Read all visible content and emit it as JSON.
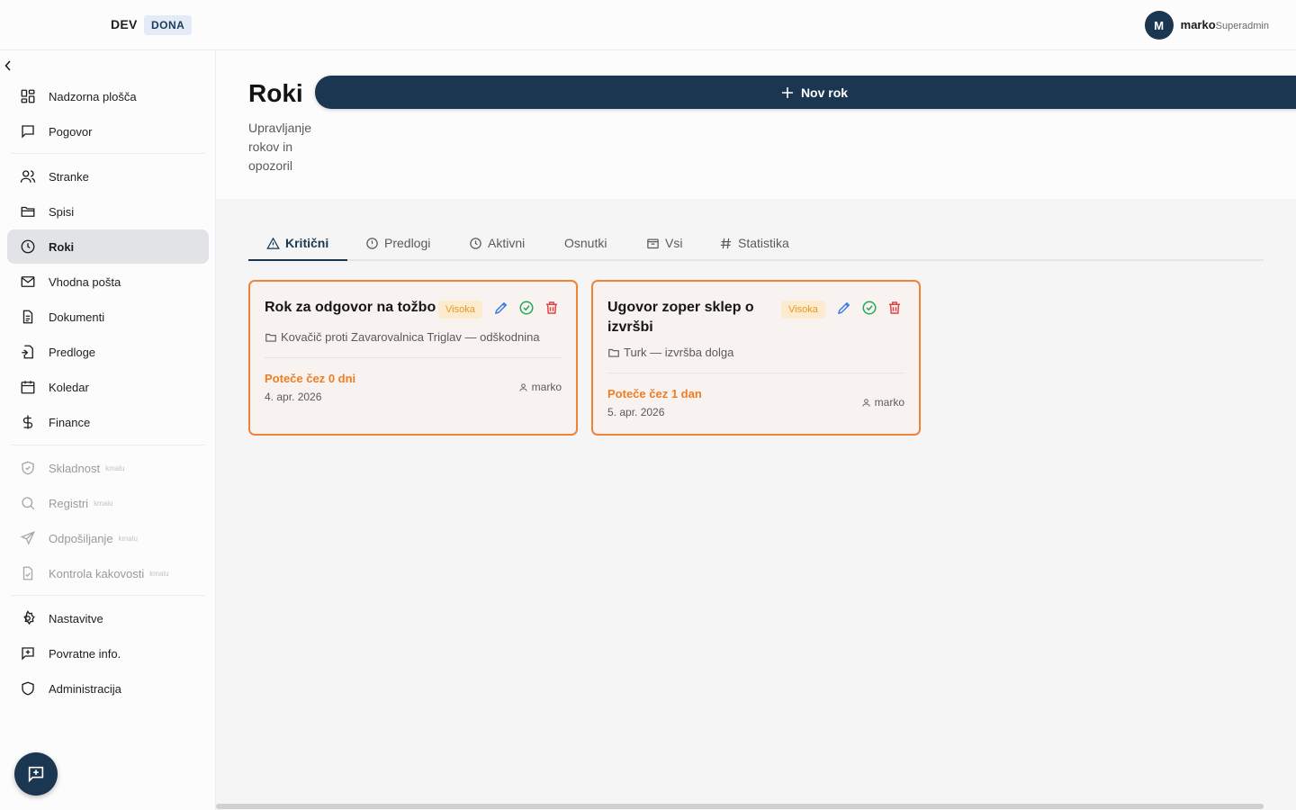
{
  "header": {
    "env": "DEV",
    "tenant": "DONA",
    "user": {
      "initial": "M",
      "name": "marko",
      "role": "Superadmin"
    }
  },
  "sidebar": {
    "items": [
      {
        "label": "Nadzorna plošča",
        "icon": "dashboard-icon"
      },
      {
        "label": "Pogovor",
        "icon": "chat-icon"
      },
      {
        "label": "Stranke",
        "icon": "users-icon"
      },
      {
        "label": "Spisi",
        "icon": "folder-icon"
      },
      {
        "label": "Roki",
        "icon": "clock-icon",
        "active": true
      },
      {
        "label": "Vhodna pošta",
        "icon": "mail-icon"
      },
      {
        "label": "Dokumenti",
        "icon": "document-icon"
      },
      {
        "label": "Predloge",
        "icon": "template-icon"
      },
      {
        "label": "Koledar",
        "icon": "calendar-icon"
      },
      {
        "label": "Finance",
        "icon": "dollar-icon"
      },
      {
        "label": "Skladnost",
        "icon": "shield-check-icon",
        "soon": "kmalu"
      },
      {
        "label": "Registri",
        "icon": "search-icon",
        "soon": "kmalu"
      },
      {
        "label": "Odpošiljanje",
        "icon": "send-icon",
        "soon": "kmalu"
      },
      {
        "label": "Kontrola kakovosti",
        "icon": "file-check-icon",
        "soon": "kmalu"
      },
      {
        "label": "Nastavitve",
        "icon": "gear-icon"
      },
      {
        "label": "Povratne info.",
        "icon": "feedback-icon"
      },
      {
        "label": "Administracija",
        "icon": "shield-icon"
      }
    ]
  },
  "page": {
    "title": "Roki",
    "subtitle": "Upravljanje rokov in opozoril",
    "new_button": "Nov rok"
  },
  "tabs": [
    {
      "label": "Kritični",
      "icon": "warning-icon",
      "active": true
    },
    {
      "label": "Predlogi",
      "icon": "alert-circle-icon"
    },
    {
      "label": "Aktivni",
      "icon": "clock-icon"
    },
    {
      "label": "Osnutki",
      "icon": ""
    },
    {
      "label": "Vsi",
      "icon": "archive-icon"
    },
    {
      "label": "Statistika",
      "icon": "hash-icon"
    }
  ],
  "cards": [
    {
      "title": "Rok za odgovor na tožbo",
      "priority": "Visoka",
      "case": "Kovačič proti Zavarovalnica Triglav — odškodnina",
      "due": "Poteče čez 0 dni",
      "date": "4. apr. 2026",
      "owner": "marko"
    },
    {
      "title_line1": "Ugovor zoper sklep o",
      "title_line2": "izvršbi",
      "priority": "Visoka",
      "case": "Turk — izvršba dolga",
      "due": "Poteče čez 1 dan",
      "date": "5. apr. 2026",
      "owner": "marko"
    }
  ],
  "colors": {
    "primary": "#1b3650",
    "critical": "#f08436",
    "badge_text": "#e59a1a"
  }
}
